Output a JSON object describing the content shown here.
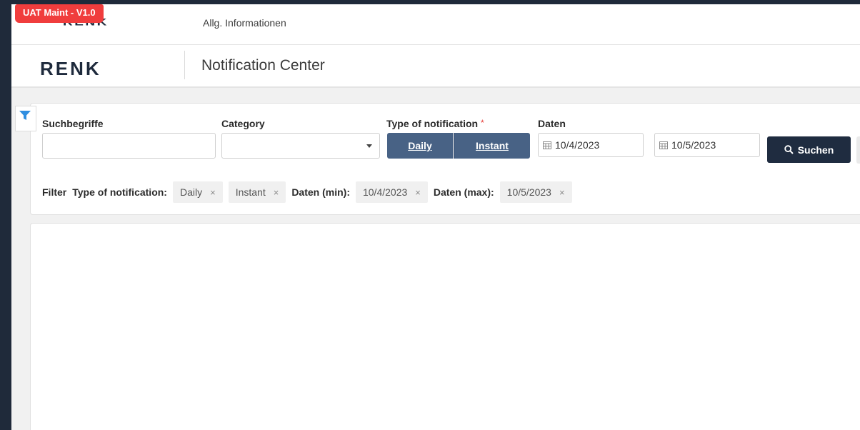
{
  "env_badge": "UAT Maint - V1.0",
  "topbar": {
    "logo": "RENK",
    "nav_link": "Allg. Informationen"
  },
  "header": {
    "logo": "RENK",
    "title": "Notification Center"
  },
  "filters": {
    "search_label": "Suchbegriffe",
    "search_value": "",
    "category_label": "Category",
    "category_value": "",
    "type_label": "Type of notification",
    "type_required": "*",
    "type_options": [
      "Daily",
      "Instant"
    ],
    "date_label": "Daten",
    "date_min": "10/4/2023",
    "date_max": "10/5/2023",
    "search_button": "Suchen"
  },
  "active_filters": {
    "label": "Filter",
    "groups": [
      {
        "label": "Type of notification:",
        "chips": [
          "Daily",
          "Instant"
        ]
      },
      {
        "label": "Daten (min):",
        "chips": [
          "10/4/2023"
        ]
      },
      {
        "label": "Daten (max):",
        "chips": [
          "10/5/2023"
        ]
      }
    ],
    "remove_glyph": "×"
  },
  "colors": {
    "background": "#1f2a3a",
    "badge": "#f03d3d",
    "toggle_active": "#486285",
    "primary_button": "#1f2c40",
    "filter_icon": "#2f8ee0"
  }
}
